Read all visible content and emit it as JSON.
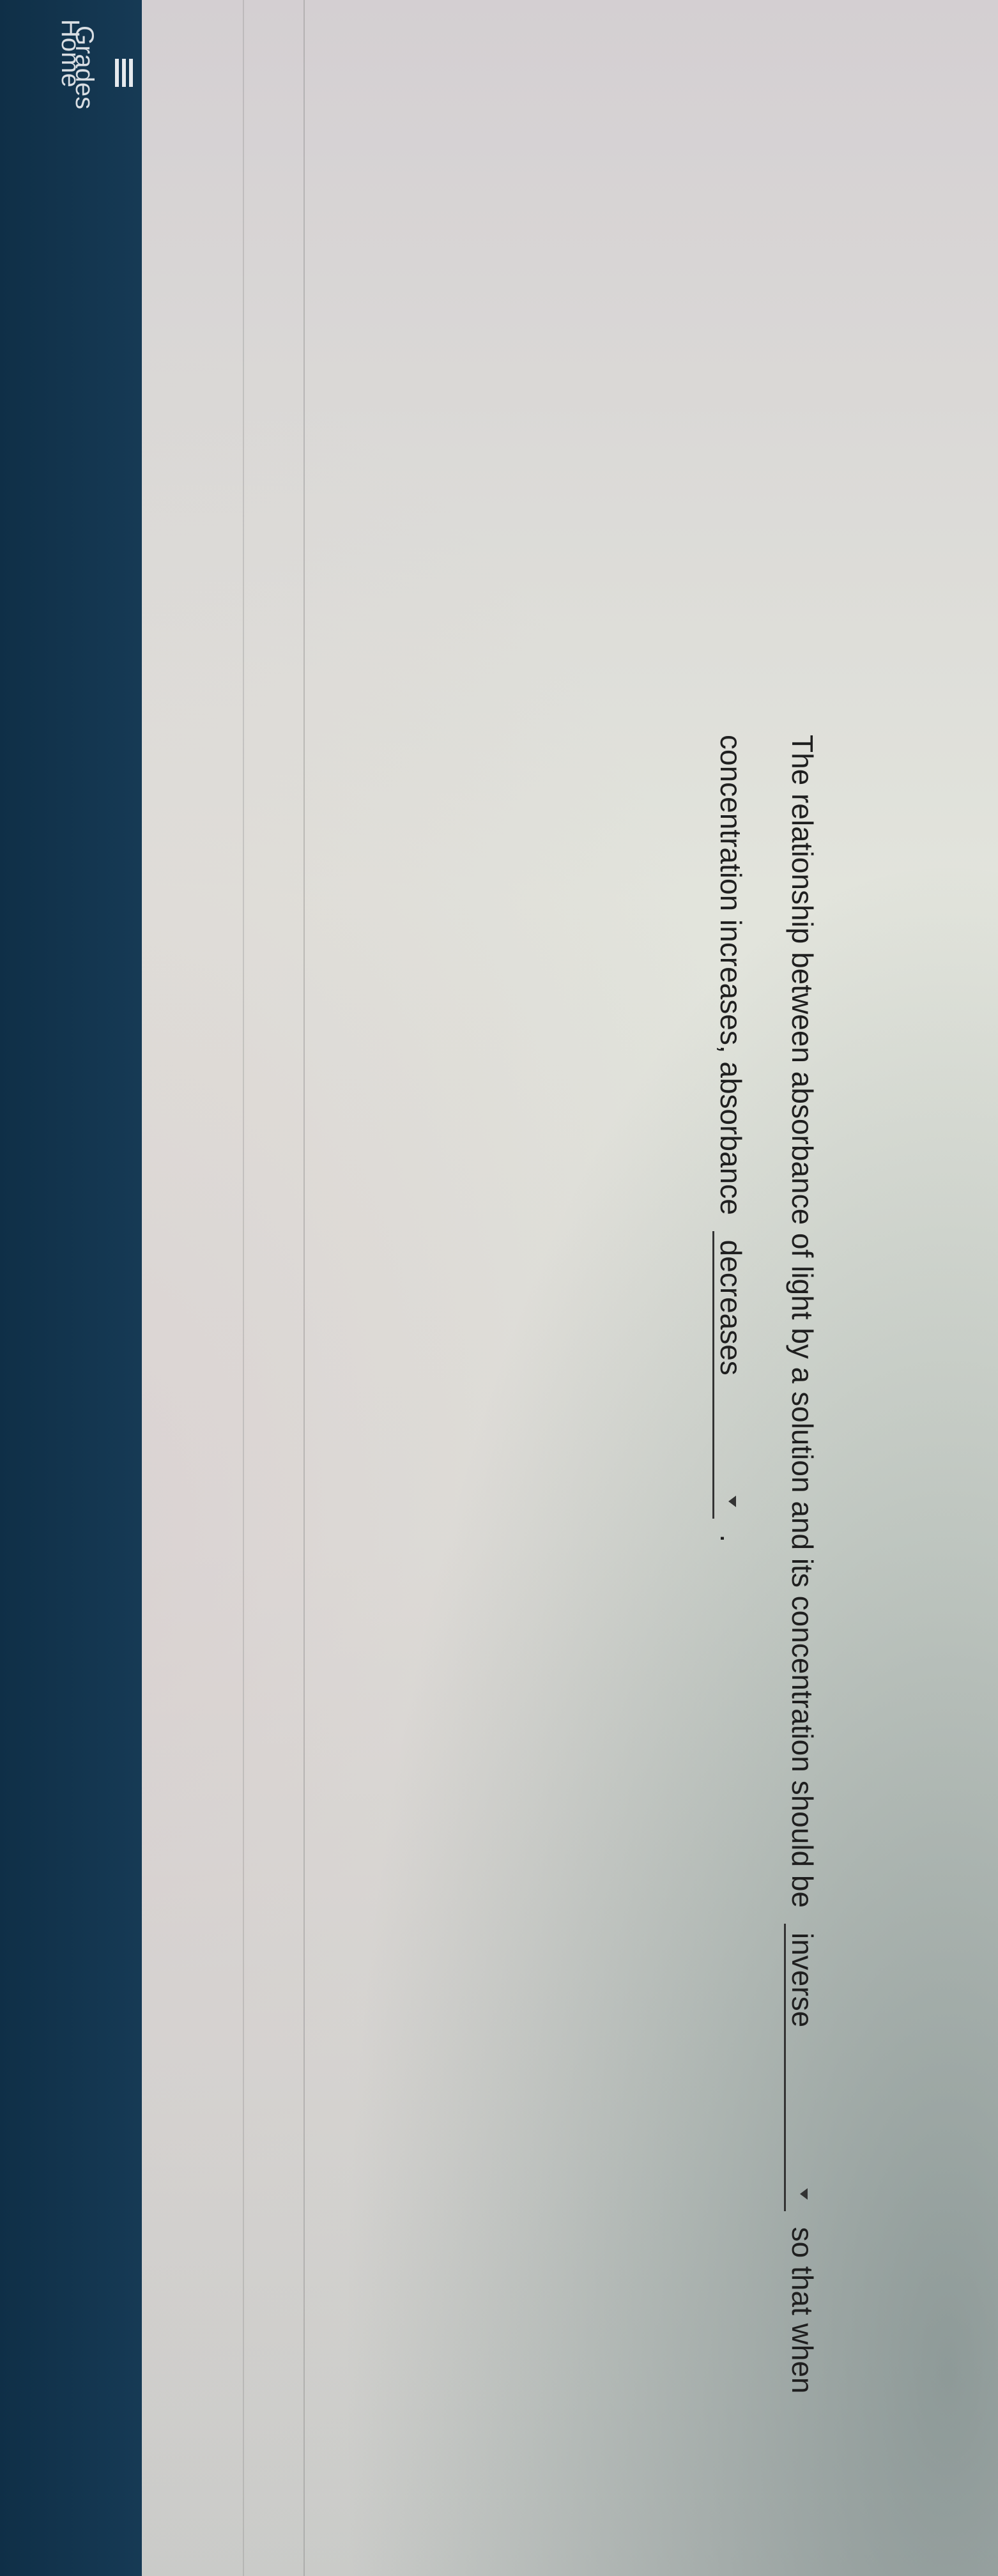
{
  "nav": {
    "home_label": "Home",
    "grades_label": "Grades",
    "grades_icon": "grades-list-icon"
  },
  "question": {
    "text_before_1": "The relationship between absorbance of light by a solution and its concentration should be",
    "select_1_value": "inverse",
    "text_between": "so that when",
    "text_line2_before": "concentration increases, absorbance",
    "select_2_value": "decreases",
    "text_end": "."
  },
  "colors": {
    "navbar": "#163a55",
    "text": "#1f1f1f"
  }
}
